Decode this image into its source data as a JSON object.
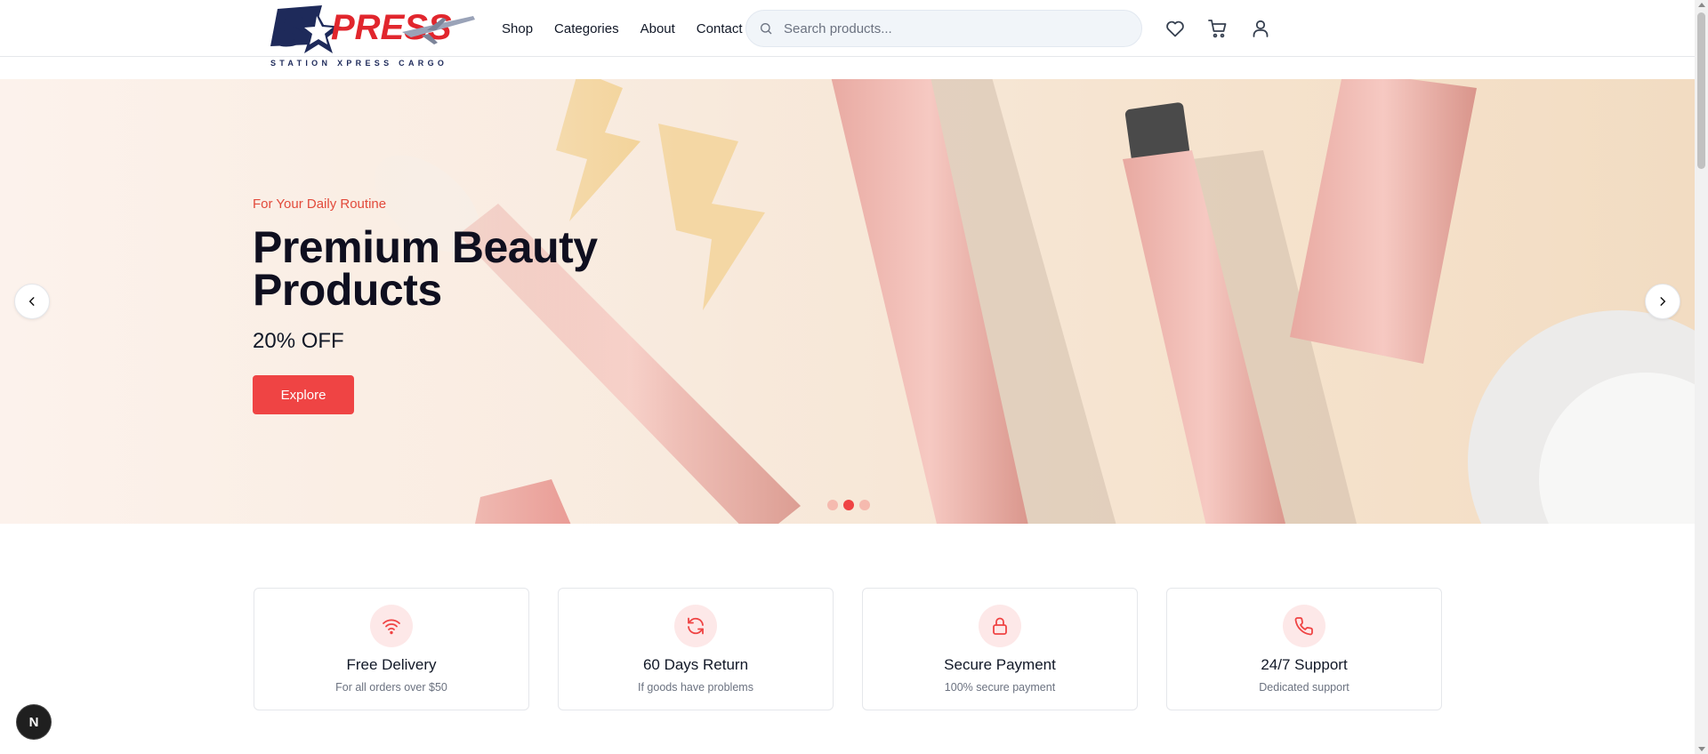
{
  "brand": {
    "logo_text": "SXPRESS",
    "tagline": "STATION XPRESS CARGO",
    "navy": "#1e2a5a",
    "red": "#e1262d"
  },
  "nav": {
    "items": [
      "Shop",
      "Categories",
      "About",
      "Contact"
    ]
  },
  "search": {
    "placeholder": "Search products...",
    "value": ""
  },
  "header_icons": [
    "heart-icon",
    "cart-icon",
    "user-icon"
  ],
  "hero": {
    "subtitle": "For Your Daily Routine",
    "title_line1": "Premium Beauty",
    "title_line2": "Products",
    "offer": "20% OFF",
    "button_label": "Explore",
    "active_slide": 2,
    "slide_count": 3,
    "accent": "#ef4444"
  },
  "features": [
    {
      "icon": "wifi-icon",
      "title": "Free Delivery",
      "desc": "For all orders over $50"
    },
    {
      "icon": "refresh-icon",
      "title": "60 Days Return",
      "desc": "If goods have problems"
    },
    {
      "icon": "lock-icon",
      "title": "Secure Payment",
      "desc": "100% secure payment"
    },
    {
      "icon": "phone-icon",
      "title": "24/7 Support",
      "desc": "Dedicated support"
    }
  ],
  "dev_badge": "N"
}
